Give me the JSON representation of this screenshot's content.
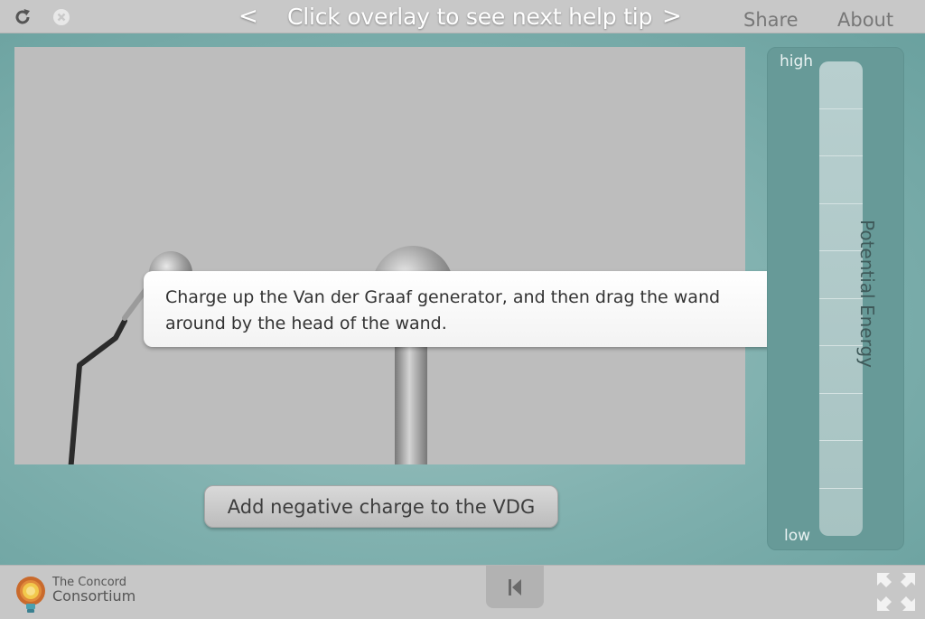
{
  "topbar": {
    "help_tip": "Click overlay to see next help tip",
    "prev_symbol": "<",
    "next_symbol": ">",
    "share_label": "Share",
    "about_label": "About"
  },
  "tooltip": {
    "text": "Charge up the Van der Graaf generator, and then drag the wand around by the head of the wand."
  },
  "controls": {
    "add_negative_label": "Add negative charge to the VDG"
  },
  "energy_meter": {
    "high_label": "high",
    "low_label": "low",
    "title": "Potential Energy",
    "level": 0
  },
  "footer": {
    "logo_line1": "The Concord",
    "logo_line2": "Consortium"
  },
  "colors": {
    "background": "#6fa5a3",
    "canvas": "#bdbdbd",
    "meter": "#679a98"
  }
}
